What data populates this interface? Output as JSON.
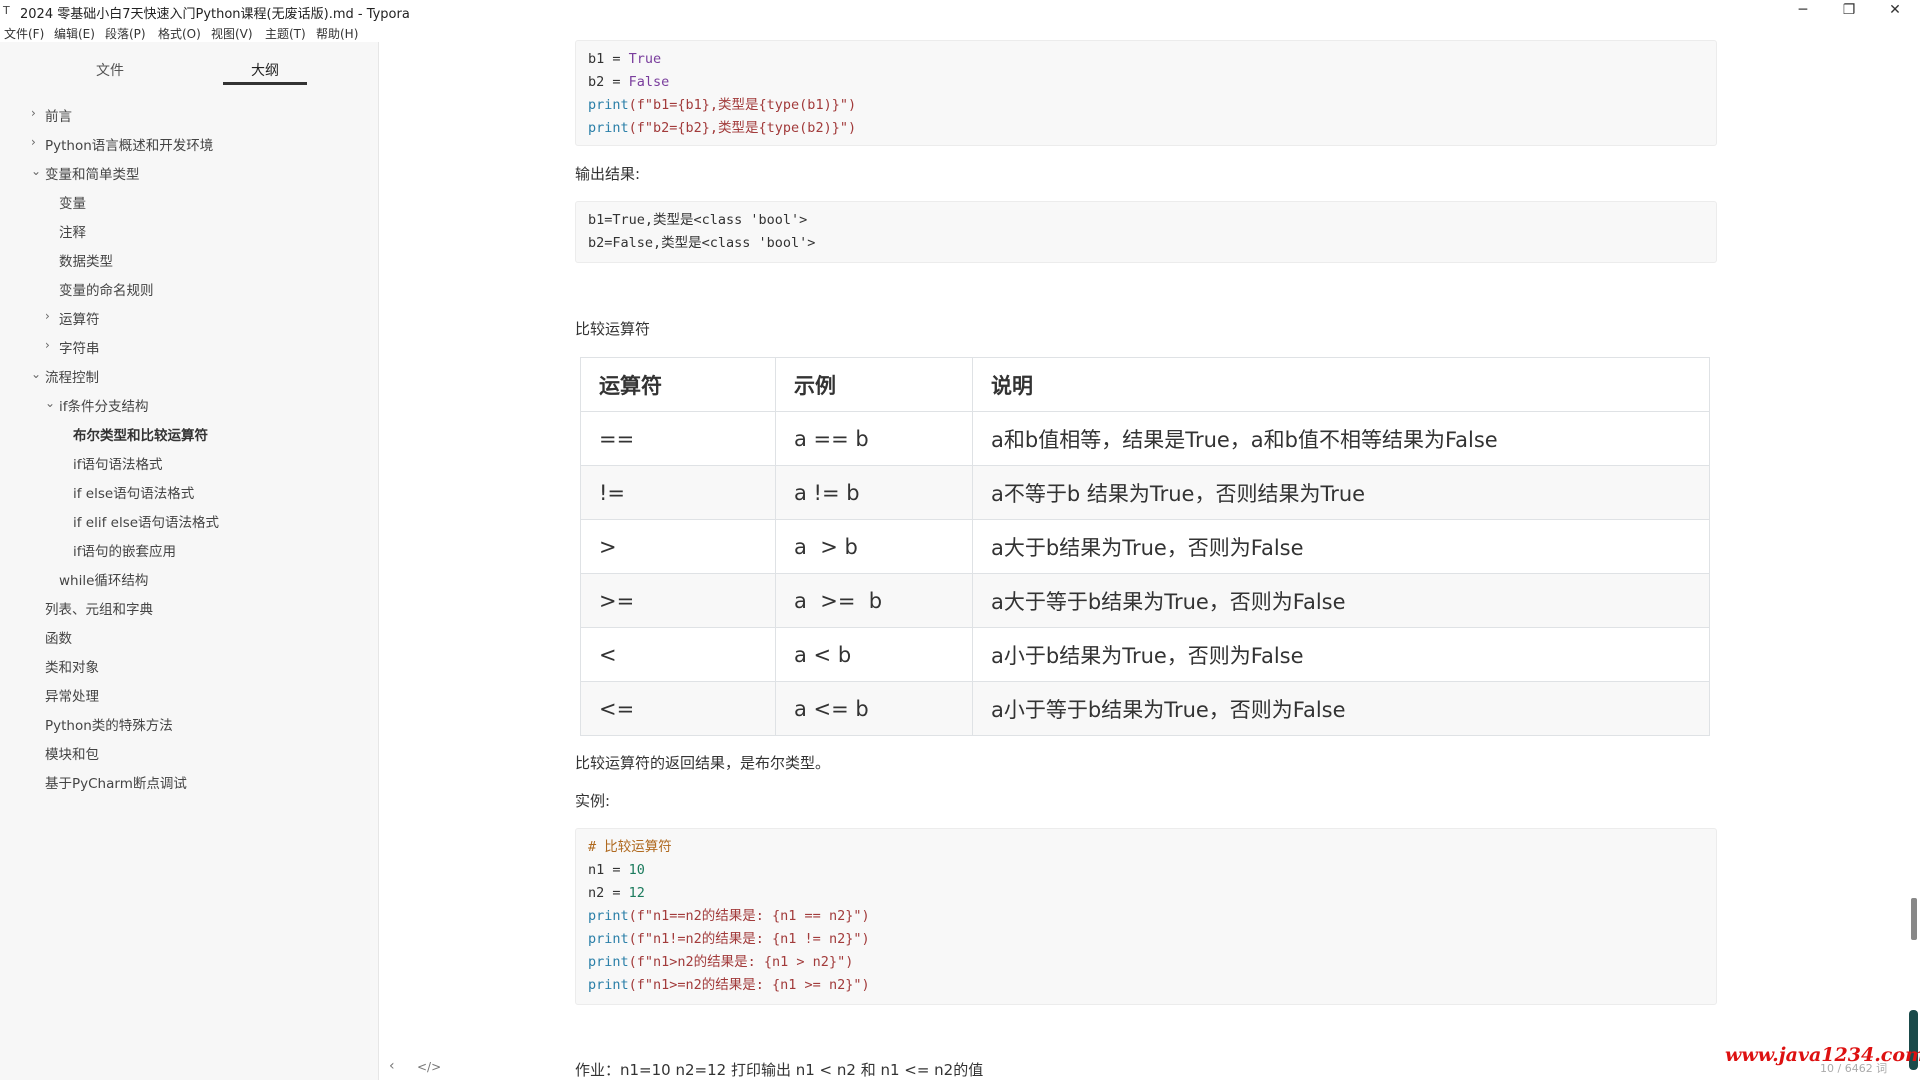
{
  "window": {
    "title": "2024 零基础小白7天快速入门Python课程(无废话版).md - Typora",
    "controls": {
      "minimize": "─",
      "restore": "❐",
      "close": "✕"
    }
  },
  "menu": [
    "文件(F)",
    "编辑(E)",
    "段落(P)",
    "格式(O)",
    "视图(V)",
    "主题(T)",
    "帮助(H)"
  ],
  "sidebar": {
    "tabs": {
      "files": "文件",
      "outline": "大纲"
    },
    "outline": [
      {
        "label": "前言",
        "level": 1,
        "expander": "collapsed"
      },
      {
        "label": "Python语言概述和开发环境",
        "level": 1,
        "expander": "collapsed"
      },
      {
        "label": "变量和简单类型",
        "level": 1,
        "expander": "expanded"
      },
      {
        "label": "变量",
        "level": 2,
        "expander": "none"
      },
      {
        "label": "注释",
        "level": 2,
        "expander": "none"
      },
      {
        "label": "数据类型",
        "level": 2,
        "expander": "none"
      },
      {
        "label": "变量的命名规则",
        "level": 2,
        "expander": "none"
      },
      {
        "label": "运算符",
        "level": 2,
        "expander": "collapsed"
      },
      {
        "label": "字符串",
        "level": 2,
        "expander": "collapsed"
      },
      {
        "label": "流程控制",
        "level": 1,
        "expander": "expanded"
      },
      {
        "label": "if条件分支结构",
        "level": 2,
        "expander": "expanded"
      },
      {
        "label": "布尔类型和比较运算符",
        "level": 3,
        "expander": "none",
        "current": true
      },
      {
        "label": "if语句语法格式",
        "level": 3,
        "expander": "none"
      },
      {
        "label": "if else语句语法格式",
        "level": 3,
        "expander": "none"
      },
      {
        "label": "if elif else语句语法格式",
        "level": 3,
        "expander": "none"
      },
      {
        "label": "if语句的嵌套应用",
        "level": 3,
        "expander": "none"
      },
      {
        "label": "while循环结构",
        "level": 2,
        "expander": "none"
      },
      {
        "label": "列表、元组和字典",
        "level": 1,
        "expander": "none"
      },
      {
        "label": "函数",
        "level": 1,
        "expander": "none"
      },
      {
        "label": "类和对象",
        "level": 1,
        "expander": "none"
      },
      {
        "label": "异常处理",
        "level": 1,
        "expander": "none"
      },
      {
        "label": "Python类的特殊方法",
        "level": 1,
        "expander": "none"
      },
      {
        "label": "模块和包",
        "level": 1,
        "expander": "none"
      },
      {
        "label": "基于PyCharm断点调试",
        "level": 1,
        "expander": "none"
      }
    ]
  },
  "content": {
    "code1": {
      "lines": [
        [
          {
            "t": "b1 = ",
            "c": ""
          },
          {
            "t": "True",
            "c": "kw"
          }
        ],
        [
          {
            "t": "b2 = ",
            "c": ""
          },
          {
            "t": "False",
            "c": "kw"
          }
        ],
        [
          {
            "t": "print",
            "c": "fn"
          },
          {
            "t": "(f\"b1={b1},类型是{type(b1)}\")",
            "c": "str"
          }
        ],
        [
          {
            "t": "print",
            "c": "fn"
          },
          {
            "t": "(f\"b2={b2},类型是{type(b2)}\")",
            "c": "str"
          }
        ]
      ]
    },
    "output_label": "输出结果:",
    "output": [
      "b1=True,类型是<class 'bool'>",
      "b2=False,类型是<class 'bool'>"
    ],
    "heading": "比较运算符",
    "table": {
      "headers": [
        "运算符",
        "示例",
        "说明"
      ],
      "rows": [
        [
          "==",
          "a == b",
          "a和b值相等，结果是True，a和b值不相等结果为False"
        ],
        [
          "!=",
          "a != b",
          "a不等于b 结果为True，否则结果为True"
        ],
        [
          ">",
          "a  > b",
          "a大于b结果为True，否则为False"
        ],
        [
          ">=",
          "a  >=  b",
          "a大于等于b结果为True，否则为False"
        ],
        [
          "<",
          "a < b",
          "a小于b结果为True，否则为False"
        ],
        [
          "<=",
          "a <= b",
          "a小于等于b结果为True，否则为False"
        ]
      ]
    },
    "note": "比较运算符的返回结果，是布尔类型。",
    "example_label": "实例:",
    "code2": {
      "lines": [
        [
          {
            "t": "# 比较运算符",
            "c": "cmt"
          }
        ],
        [
          {
            "t": "n1 = ",
            "c": ""
          },
          {
            "t": "10",
            "c": "num"
          }
        ],
        [
          {
            "t": "n2 = ",
            "c": ""
          },
          {
            "t": "12",
            "c": "num"
          }
        ],
        [
          {
            "t": "print",
            "c": "fn"
          },
          {
            "t": "(f\"n1==n2的结果是: {n1 == n2}\")",
            "c": "str"
          }
        ],
        [
          {
            "t": "print",
            "c": "fn"
          },
          {
            "t": "(f\"n1!=n2的结果是: {n1 != n2}\")",
            "c": "str"
          }
        ],
        [
          {
            "t": "print",
            "c": "fn"
          },
          {
            "t": "(f\"n1>n2的结果是: {n1 > n2}\")",
            "c": "str"
          }
        ],
        [
          {
            "t": "print",
            "c": "fn"
          },
          {
            "t": "(f\"n1>=n2的结果是: {n1 >= n2}\")",
            "c": "str"
          }
        ]
      ]
    },
    "homework": "作业：n1=10 n2=12 打印输出 n1 < n2  和 n1 <= n2的值"
  },
  "status": {
    "word_count": "10 / 6462 词"
  },
  "watermark": "www.java1234.com",
  "bottom_icons": {
    "back": "‹",
    "source": "</>"
  }
}
